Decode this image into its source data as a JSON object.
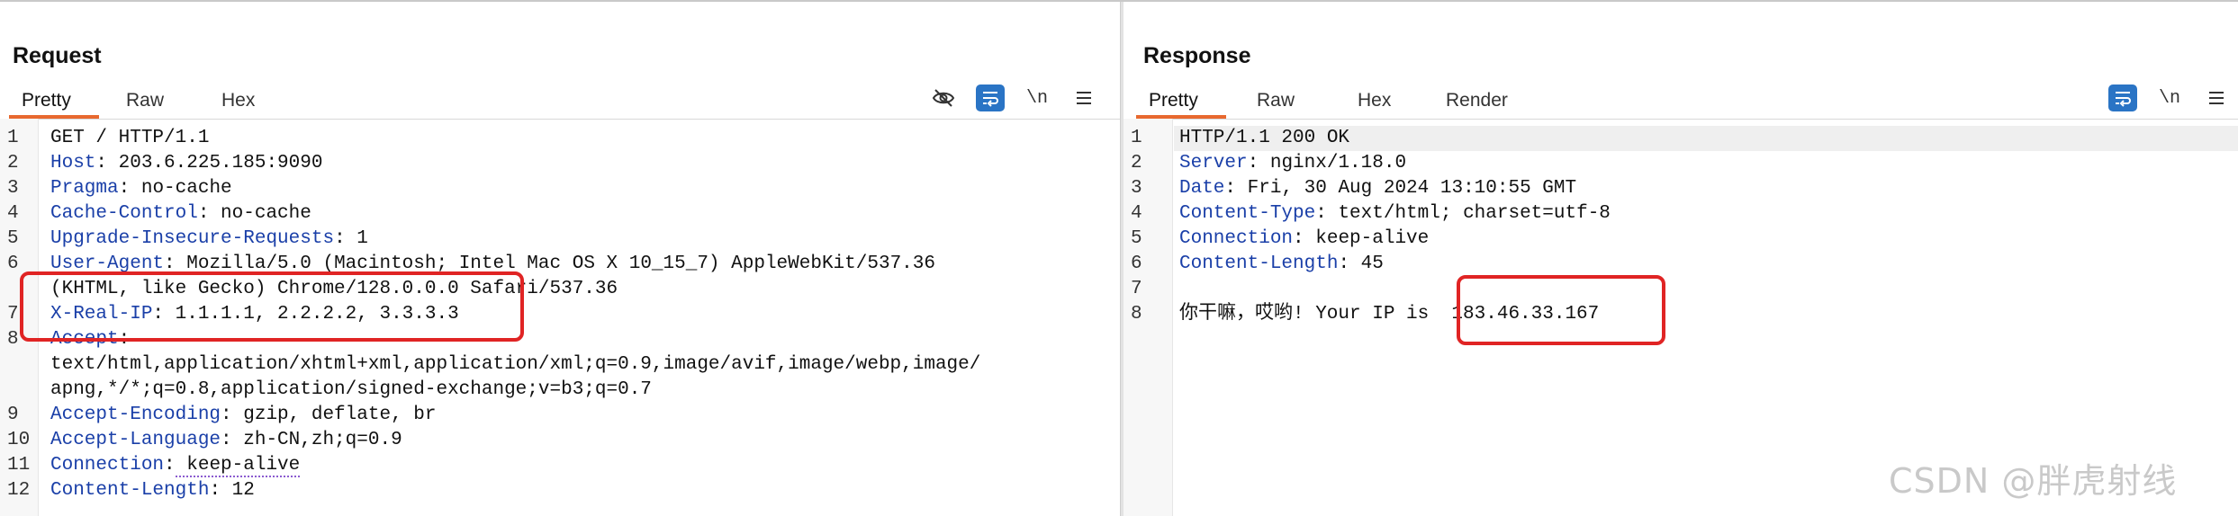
{
  "request": {
    "title": "Request",
    "tabs": [
      "Pretty",
      "Raw",
      "Hex"
    ],
    "active_tab": "Pretty",
    "tools": {
      "newline_label": "\\n"
    },
    "lines": [
      {
        "no": "1",
        "key": "",
        "text": "GET / HTTP/1.1"
      },
      {
        "no": "2",
        "key": "Host",
        "text": " 203.6.225.185:9090"
      },
      {
        "no": "3",
        "key": "Pragma",
        "text": " no-cache"
      },
      {
        "no": "4",
        "key": "Cache-Control",
        "text": " no-cache"
      },
      {
        "no": "5",
        "key": "Upgrade-Insecure-Requests",
        "text": " 1"
      },
      {
        "no": "6",
        "key": "User-Agent",
        "text": " Mozilla/5.0 (Macintosh; Intel Mac OS X 10_15_7) AppleWebKit/537.36"
      },
      {
        "no": "",
        "key": "",
        "text": "(KHTML, like Gecko) Chrome/128.0.0.0 Safari/537.36"
      },
      {
        "no": "7",
        "key": "X-Real-IP",
        "text": " 1.1.1.1, 2.2.2.2, 3.3.3.3"
      },
      {
        "no": "8",
        "key": "Accept",
        "text": ""
      },
      {
        "no": "",
        "key": "",
        "text": "text/html,application/xhtml+xml,application/xml;q=0.9,image/avif,image/webp,image/"
      },
      {
        "no": "",
        "key": "",
        "text": "apng,*/*;q=0.8,application/signed-exchange;v=b3;q=0.7"
      },
      {
        "no": "9",
        "key": "Accept-Encoding",
        "text": " gzip, deflate, br"
      },
      {
        "no": "10",
        "key": "Accept-Language",
        "text": " zh-CN,zh;q=0.9"
      },
      {
        "no": "11",
        "key": "Connection",
        "text": " keep-alive"
      },
      {
        "no": "12",
        "key": "Content-Length",
        "text": " 12"
      }
    ]
  },
  "response": {
    "title": "Response",
    "tabs": [
      "Pretty",
      "Raw",
      "Hex",
      "Render"
    ],
    "active_tab": "Pretty",
    "tools": {
      "newline_label": "\\n"
    },
    "lines": [
      {
        "no": "1",
        "key": "",
        "text": "HTTP/1.1 200 OK"
      },
      {
        "no": "2",
        "key": "Server",
        "text": " nginx/1.18.0"
      },
      {
        "no": "3",
        "key": "Date",
        "text": " Fri, 30 Aug 2024 13:10:55 GMT"
      },
      {
        "no": "4",
        "key": "Content-Type",
        "text": " text/html; charset=utf-8"
      },
      {
        "no": "5",
        "key": "Connection",
        "text": " keep-alive"
      },
      {
        "no": "6",
        "key": "Content-Length",
        "text": " 45"
      },
      {
        "no": "7",
        "key": "",
        "text": ""
      },
      {
        "no": "8",
        "key": "",
        "text": "你干嘛，哎哟! Your IP is  183.46.33.167"
      }
    ]
  },
  "watermark": "CSDN @胖虎射线",
  "colors": {
    "accent": "#2a74c5",
    "tab_underline": "#e8692f",
    "highlight_box": "#e02424",
    "header_key": "#1a3fa8"
  }
}
